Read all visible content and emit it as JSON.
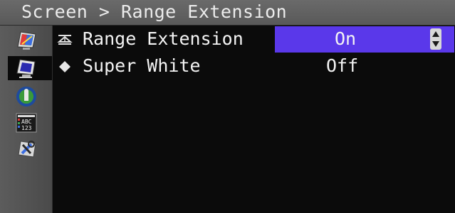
{
  "header": {
    "breadcrumb": "Screen > Range Extension"
  },
  "sidebar": {
    "items": [
      {
        "name": "color-adjust-icon",
        "selected": false
      },
      {
        "name": "screen-icon",
        "selected": true
      },
      {
        "name": "power-save-icon",
        "selected": false
      },
      {
        "name": "language-icon",
        "selected": false,
        "text": "ABC 123"
      },
      {
        "name": "tools-icon",
        "selected": false
      }
    ]
  },
  "menu": {
    "rows": [
      {
        "icon": "range-extension-icon",
        "label": "Range Extension",
        "value": "On",
        "selected": true
      },
      {
        "icon": "diamond-icon",
        "label": "Super White",
        "value": "Off",
        "selected": false
      }
    ]
  },
  "colors": {
    "highlight": "#5a38ea",
    "title_bar": "#626262",
    "background": "#0b0b0b"
  }
}
